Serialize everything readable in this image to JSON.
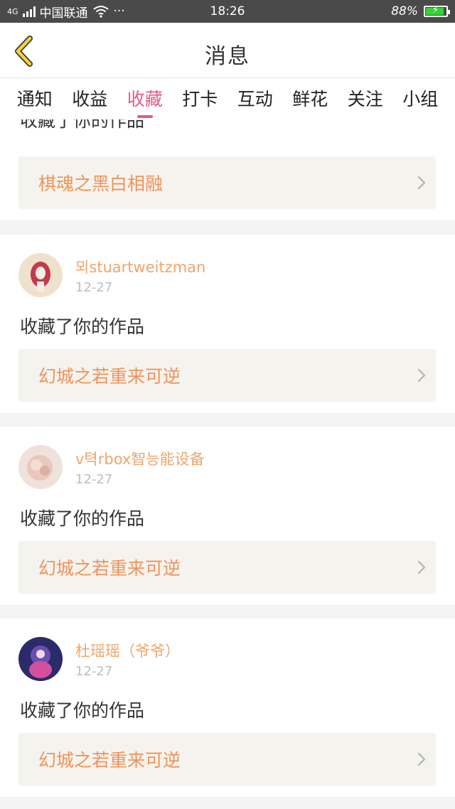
{
  "status_bar": {
    "network": "4G",
    "carrier": "中国联通",
    "dots": "···",
    "time": "18:26",
    "battery": "88%",
    "battery_level": 0.88
  },
  "header": {
    "title": "消息",
    "back_icon": "chevron-left-icon"
  },
  "tabs": [
    {
      "label": "通知",
      "active": false
    },
    {
      "label": "收益",
      "active": false
    },
    {
      "label": "收藏",
      "active": true
    },
    {
      "label": "打卡",
      "active": false
    },
    {
      "label": "互动",
      "active": false
    },
    {
      "label": "鲜花",
      "active": false
    },
    {
      "label": "关注",
      "active": false
    },
    {
      "label": "小组",
      "active": false
    }
  ],
  "notifications": [
    {
      "user": "",
      "date": "",
      "action": "收藏了你的作品",
      "work": "棋魂之黑白相融"
    },
    {
      "user": "뫼stuartweitzman",
      "date": "12-27",
      "action": "收藏了你的作品",
      "work": "幻城之若重来可逆"
    },
    {
      "user": "v텩rbox智능能设备",
      "date": "12-27",
      "action": "收藏了你的作品",
      "work": "幻城之若重来可逆"
    },
    {
      "user": "杜瑶瑶（爷爷）",
      "date": "12-27",
      "action": "收藏了你的作品",
      "work": "幻城之若重来可逆"
    }
  ],
  "colors": {
    "accent": "#e8588a",
    "username": "#f0a56b",
    "work_title": "#f0935a",
    "back_icon": "#f5d33a"
  }
}
